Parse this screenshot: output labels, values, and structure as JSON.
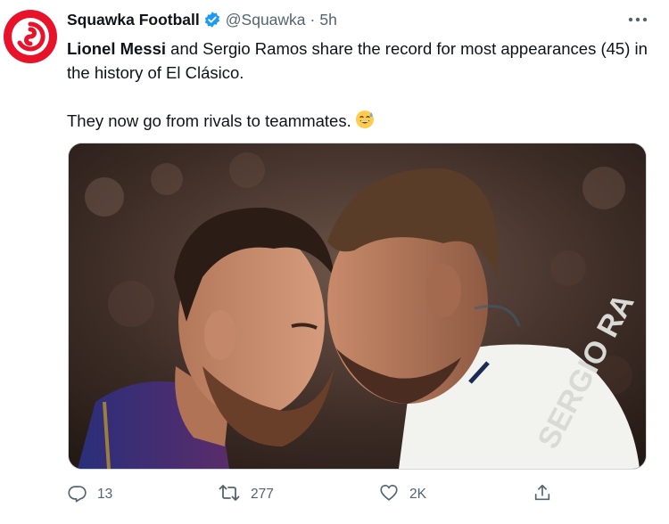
{
  "tweet": {
    "display_name": "Squawka Football",
    "handle": "@Squawka",
    "separator": "·",
    "time": "5h",
    "text_bold": "Lionel Messi",
    "text_rest": " and Sergio Ramos share the record for most appearances (45) in the history of El Clásico.",
    "text_second": "They now go from rivals to teammates.",
    "emoji": "sweat-smile-emoji",
    "image_shirt_text": "SERGIO RA"
  },
  "actions": {
    "replies": "13",
    "retweets": "277",
    "likes": "2K"
  },
  "colors": {
    "avatar_red": "#e8132a",
    "verified_blue": "#1d9bf0",
    "secondary_text": "#536471",
    "primary_text": "#0f1419"
  },
  "icons": [
    "reply-icon",
    "retweet-icon",
    "like-icon",
    "share-icon",
    "more-icon",
    "verified-icon"
  ]
}
